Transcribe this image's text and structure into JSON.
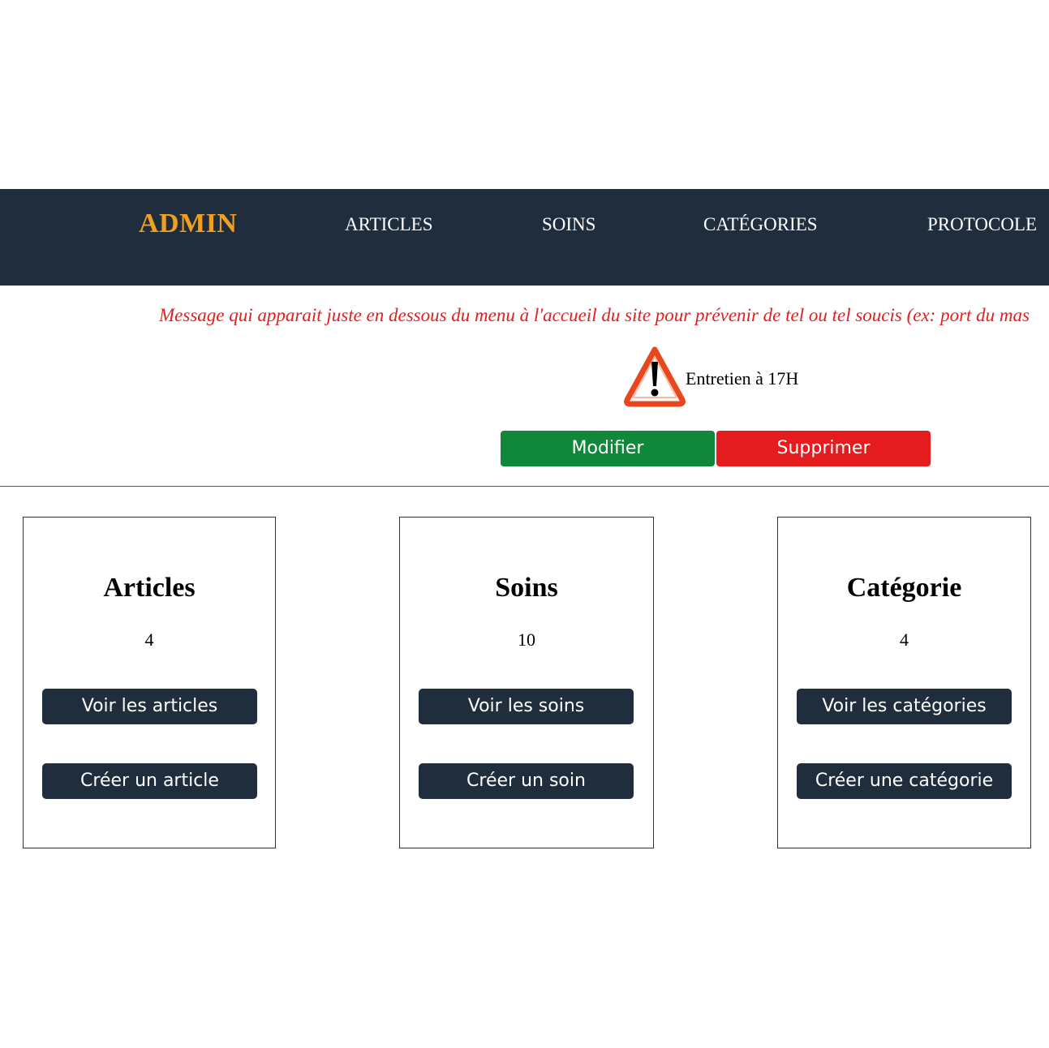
{
  "nav": {
    "brand": "ADMIN",
    "links": [
      "ARTICLES",
      "SOINS",
      "CATÉGORIES",
      "PROTOCOLE"
    ]
  },
  "alert_message": "Message qui apparait juste en dessous du menu à l'accueil du site pour prévenir de tel ou tel soucis (ex: port du mas",
  "maintenance": {
    "icon": "warning-icon",
    "text": "Entretien à 17H"
  },
  "actions": {
    "modify_label": "Modifier",
    "delete_label": "Supprimer"
  },
  "cards": [
    {
      "title": "Articles",
      "count": "4",
      "view_label": "Voir les articles",
      "create_label": "Créer un article"
    },
    {
      "title": "Soins",
      "count": "10",
      "view_label": "Voir les soins",
      "create_label": "Créer un soin"
    },
    {
      "title": "Catégorie",
      "count": "4",
      "view_label": "Voir les catégories",
      "create_label": "Créer une catégorie"
    }
  ],
  "colors": {
    "navbar_bg": "#1f2d3d",
    "brand": "#f0a020",
    "alert_text": "#e02020",
    "modify_button": "#10873a",
    "delete_button": "#e51c1f",
    "card_button": "#1f2d3d"
  }
}
